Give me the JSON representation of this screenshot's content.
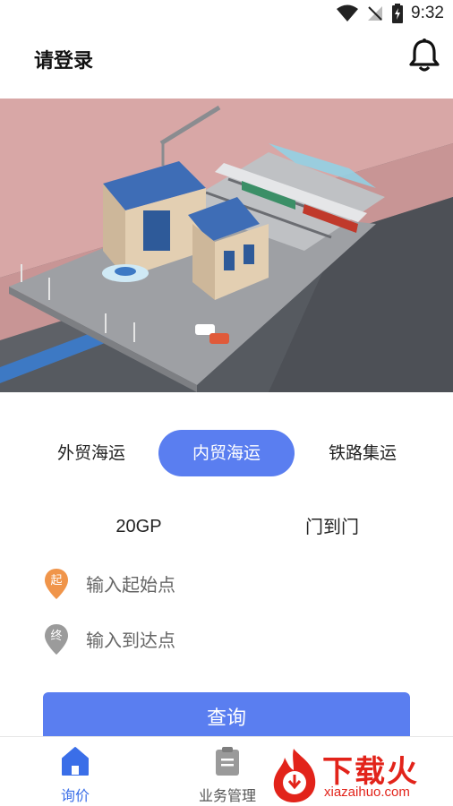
{
  "status_bar": {
    "time": "9:32"
  },
  "header": {
    "title": "请登录",
    "bell_icon": "bell-icon"
  },
  "banner": {
    "slides": 2,
    "active_slide": 2
  },
  "tabs": [
    {
      "label": "外贸海运",
      "active": false
    },
    {
      "label": "内贸海运",
      "active": true
    },
    {
      "label": "铁路集运",
      "active": false
    }
  ],
  "options": {
    "container": "20GP",
    "service": "门到门"
  },
  "origin": {
    "pin_label": "起",
    "placeholder": "输入起始点",
    "color": "#f0954a"
  },
  "destination": {
    "pin_label": "终",
    "placeholder": "输入到达点",
    "color": "#9b9b9b"
  },
  "query_button": "查询",
  "tabbar": [
    {
      "label": "询价",
      "icon": "home-icon",
      "active": true
    },
    {
      "label": "业务管理",
      "icon": "clipboard-icon",
      "active": false
    }
  ],
  "watermark": {
    "brand": "下载火",
    "url": "xiazaihuo.com"
  },
  "colors": {
    "accent": "#5a7ef0",
    "active_tab_text": "#3a6ee8"
  }
}
